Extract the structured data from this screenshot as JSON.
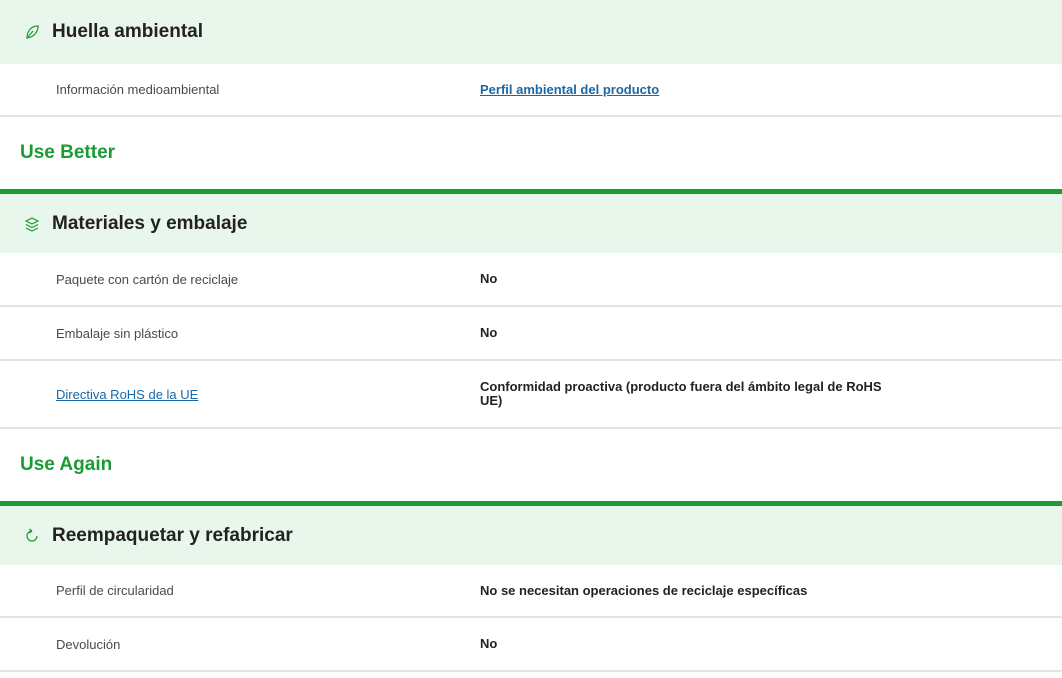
{
  "environmental": {
    "title": "Huella ambiental",
    "icon": "leaf-icon",
    "rows": [
      {
        "label": "Información medioambiental",
        "value": "Perfil ambiental del producto"
      }
    ]
  },
  "use_better": {
    "group_title": "Use Better",
    "section_title": "Materiales y embalaje",
    "icon": "layers-icon",
    "rows": [
      {
        "label": "Paquete con cartón de reciclaje",
        "value": "No"
      },
      {
        "label": "Embalaje sin plástico",
        "value": "No"
      },
      {
        "label": "Directiva RoHS de la UE",
        "value": "Conformidad proactiva (producto fuera del ámbito legal de RoHS UE)"
      }
    ]
  },
  "use_again": {
    "group_title": "Use Again",
    "section_title": "Reempaquetar y refabricar",
    "icon": "refresh-icon",
    "rows": [
      {
        "label": "Perfil de circularidad",
        "value": "No se necesitan operaciones de reciclaje específicas"
      },
      {
        "label": "Devolución",
        "value": "No"
      }
    ]
  },
  "colors": {
    "accent_green": "#1a9b34",
    "header_bg": "#e9f6ec",
    "link_blue": "#1868a8"
  }
}
